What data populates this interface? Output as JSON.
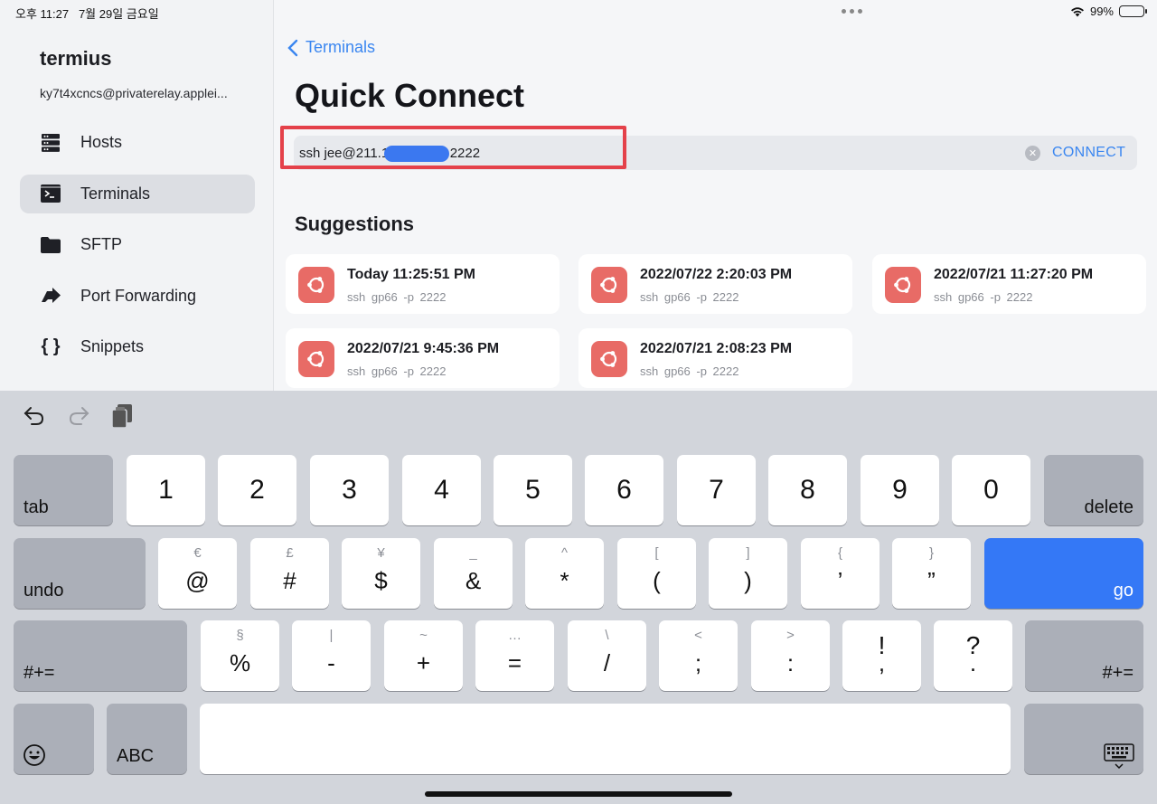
{
  "status_bar": {
    "time": "오후 11:27",
    "date": "7월 29일 금요일",
    "battery": "99%"
  },
  "sidebar": {
    "brand": "termius",
    "email": "ky7t4xcncs@privaterelay.applei...",
    "items": [
      {
        "label": "Hosts",
        "icon": "hosts-icon"
      },
      {
        "label": "Terminals",
        "icon": "terminal-icon",
        "active": true
      },
      {
        "label": "SFTP",
        "icon": "folder-icon"
      },
      {
        "label": "Port Forwarding",
        "icon": "port-forwarding-icon"
      },
      {
        "label": "Snippets",
        "icon": "snippets-icon"
      }
    ]
  },
  "main": {
    "back_label": "Terminals",
    "title": "Quick Connect",
    "quick_connect": {
      "value": "ssh jee@211.1            -p 2222",
      "connect_label": "CONNECT"
    },
    "suggestions_title": "Suggestions",
    "suggestions": [
      {
        "timestamp": "Today 11:25:51 PM",
        "command": "ssh gp66 -p 2222"
      },
      {
        "timestamp": "2022/07/22 2:20:03 PM",
        "command": "ssh gp66 -p 2222"
      },
      {
        "timestamp": "2022/07/21 11:27:20 PM",
        "command": "ssh gp66 -p 2222"
      },
      {
        "timestamp": "2022/07/21 9:45:36 PM",
        "command": "ssh gp66 -p 2222"
      },
      {
        "timestamp": "2022/07/21 2:08:23 PM",
        "command": "ssh gp66 -p 2222"
      }
    ]
  },
  "keyboard": {
    "row1": [
      "1",
      "2",
      "3",
      "4",
      "5",
      "6",
      "7",
      "8",
      "9",
      "0"
    ],
    "row1_left": "tab",
    "row1_right": "delete",
    "row2": [
      {
        "sub": "€",
        "main": "@"
      },
      {
        "sub": "£",
        "main": "#"
      },
      {
        "sub": "¥",
        "main": "$"
      },
      {
        "sub": "_",
        "main": "&"
      },
      {
        "sub": "^",
        "main": "*"
      },
      {
        "sub": "[",
        "main": "("
      },
      {
        "sub": "]",
        "main": ")"
      },
      {
        "sub": "{",
        "main": "’"
      },
      {
        "sub": "}",
        "main": "”"
      }
    ],
    "row2_left": "undo",
    "row2_right": "go",
    "row3": [
      {
        "sub": "§",
        "main": "%"
      },
      {
        "sub": "|",
        "main": "-"
      },
      {
        "sub": "~",
        "main": "+"
      },
      {
        "sub": "…",
        "main": "="
      },
      {
        "sub": "\\",
        "main": "/"
      },
      {
        "sub": "<",
        "main": ";"
      },
      {
        "sub": ">",
        "main": ":"
      },
      {
        "sub": "!",
        "main": ","
      },
      {
        "sub": "?",
        "main": "."
      }
    ],
    "row3_left": "#+=",
    "row3_right": "#+=",
    "abc_label": "ABC"
  }
}
